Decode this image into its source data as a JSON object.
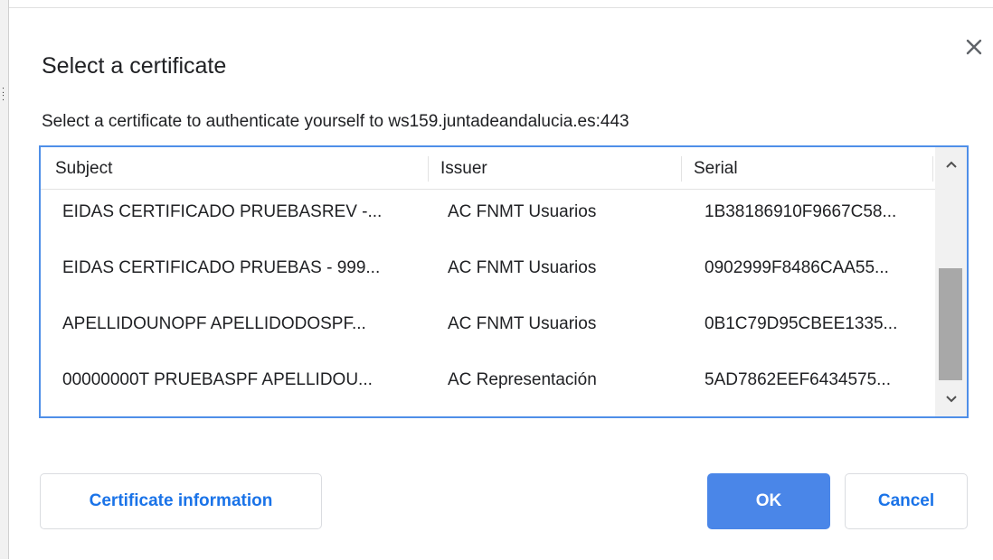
{
  "dialog": {
    "title": "Select a certificate",
    "subtitle": "Select a certificate to authenticate yourself to ws159.juntadeandalucia.es:443",
    "close_icon": "close-icon"
  },
  "table": {
    "columns": [
      "Subject",
      "Issuer",
      "Serial"
    ],
    "rows": [
      {
        "subject": "EIDAS CERTIFICADO PRUEBASREV -...",
        "issuer": "AC FNMT Usuarios",
        "serial": "1B38186910F9667C58..."
      },
      {
        "subject": "EIDAS CERTIFICADO PRUEBAS - 999...",
        "issuer": "AC FNMT Usuarios",
        "serial": "0902999F8486CAA55..."
      },
      {
        "subject": "APELLIDOUNOPF APELLIDODOSPF...",
        "issuer": "AC FNMT Usuarios",
        "serial": "0B1C79D95CBEE1335..."
      },
      {
        "subject": "00000000T PRUEBASPF APELLIDOU...",
        "issuer": "AC Representación",
        "serial": "5AD7862EEF6434575..."
      }
    ],
    "scroll_position": 0.75
  },
  "buttons": {
    "certificate_information": "Certificate information",
    "ok": "OK",
    "cancel": "Cancel"
  },
  "colors": {
    "accent": "#1a73e8",
    "primary_button": "#4a86e8",
    "focus_border": "#4f8fe8"
  }
}
